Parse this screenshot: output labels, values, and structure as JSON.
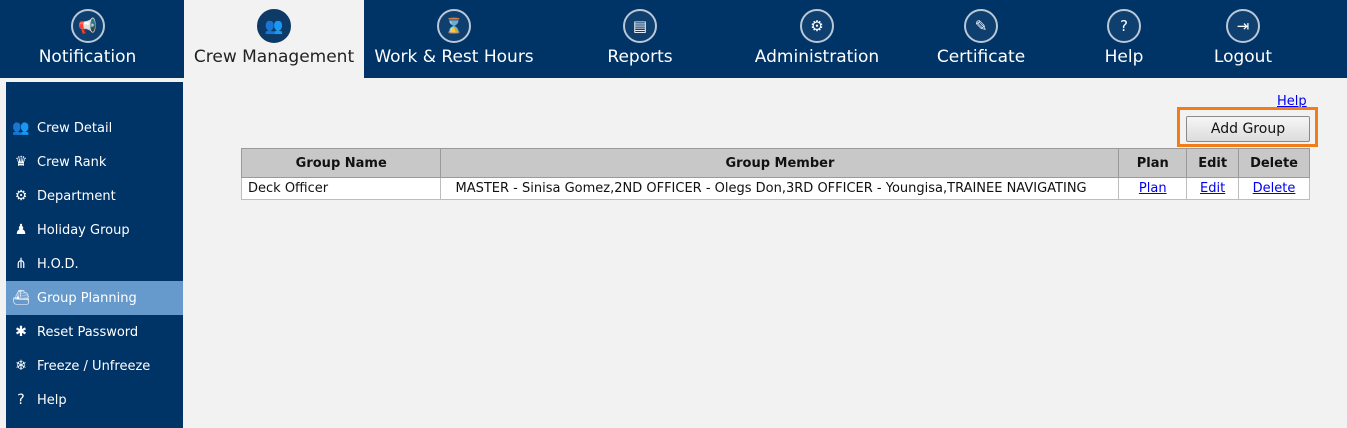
{
  "topnav": {
    "items": [
      {
        "label": "Notification",
        "icon": "megaphone-icon",
        "glyph": "📢"
      },
      {
        "label": "Crew Management",
        "icon": "crew-group-icon",
        "glyph": "👥"
      },
      {
        "label": "Work & Rest Hours",
        "icon": "hourglass-icon",
        "glyph": "⌛"
      },
      {
        "label": "Reports",
        "icon": "reports-icon",
        "glyph": "▤"
      },
      {
        "label": "Administration",
        "icon": "admin-icon",
        "glyph": "⚙"
      },
      {
        "label": "Certificate",
        "icon": "certificate-icon",
        "glyph": "✎"
      },
      {
        "label": "Help",
        "icon": "question-icon",
        "glyph": "?"
      },
      {
        "label": "Logout",
        "icon": "logout-icon",
        "glyph": "⇥"
      }
    ],
    "active": "Crew Management"
  },
  "sidebar": {
    "items": [
      {
        "label": "Crew Detail",
        "icon": "people-icon",
        "glyph": "👥"
      },
      {
        "label": "Crew Rank",
        "icon": "rank-icon",
        "glyph": "♛"
      },
      {
        "label": "Department",
        "icon": "department-icon",
        "glyph": "⚙"
      },
      {
        "label": "Holiday Group",
        "icon": "holiday-icon",
        "glyph": "♟"
      },
      {
        "label": "H.O.D.",
        "icon": "hierarchy-icon",
        "glyph": "⋔"
      },
      {
        "label": "Group Planning",
        "icon": "ship-icon",
        "glyph": "⛴"
      },
      {
        "label": "Reset Password",
        "icon": "reset-password-icon",
        "glyph": "✱"
      },
      {
        "label": "Freeze / Unfreeze",
        "icon": "snowflake-icon",
        "glyph": "❄"
      },
      {
        "label": "Help",
        "icon": "question-icon",
        "glyph": "?"
      }
    ],
    "active": "Group Planning"
  },
  "main": {
    "help_link": "Help",
    "add_group_label": "Add Group",
    "table": {
      "headers": [
        "Group Name",
        "Group Member",
        "Plan",
        "Edit",
        "Delete"
      ],
      "rows": [
        {
          "group_name": "Deck Officer",
          "group_member": "MASTER - Sinisa Gomez,2ND OFFICER - Olegs Don,3RD OFFICER - Youngisa,TRAINEE NAVIGATING",
          "plan": "Plan",
          "edit": "Edit",
          "delete": "Delete"
        }
      ]
    }
  },
  "colors": {
    "nav_bg": "#003366",
    "sidebar_active": "#6699cc",
    "highlight_border": "#f07d1a",
    "link": "#0000ee"
  }
}
